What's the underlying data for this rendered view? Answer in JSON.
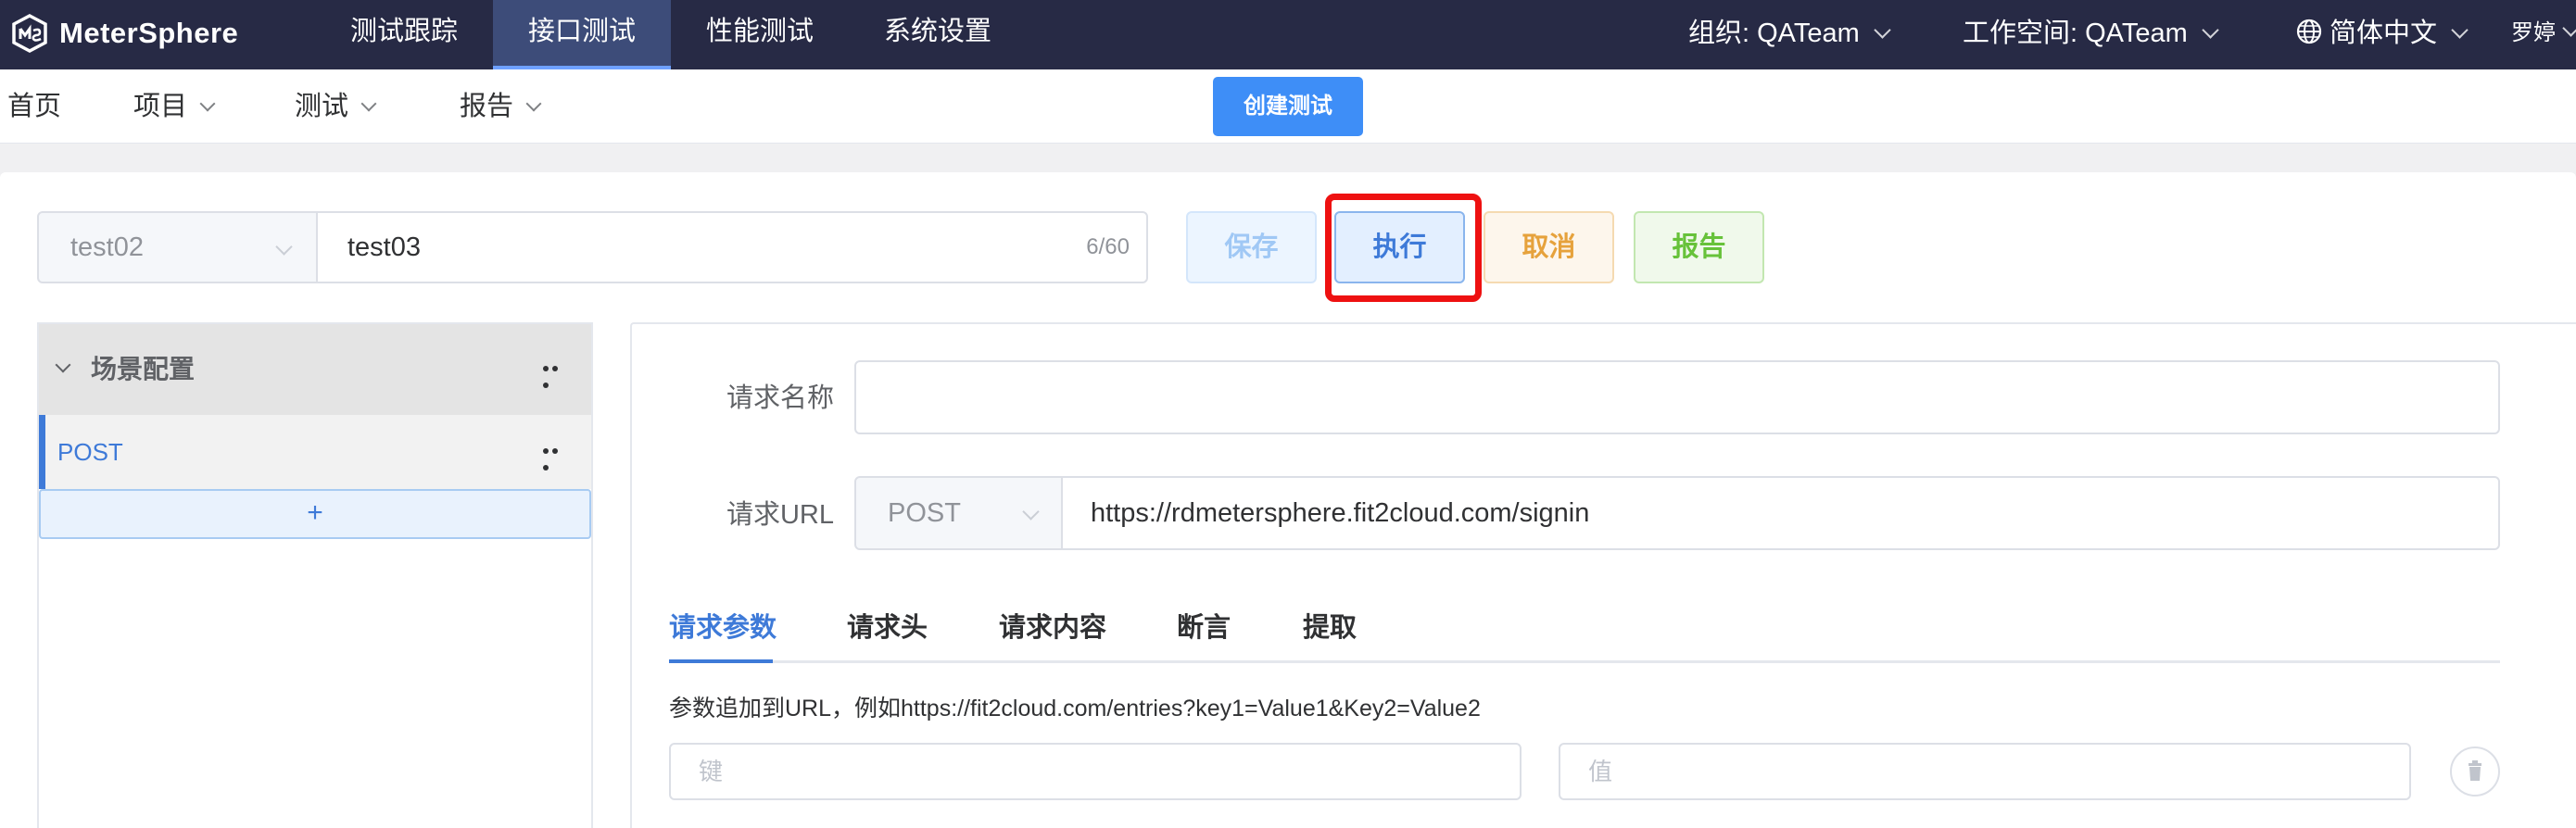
{
  "app": {
    "name": "MeterSphere"
  },
  "topnav": {
    "items": [
      {
        "label": "测试跟踪",
        "active": false
      },
      {
        "label": "接口测试",
        "active": true
      },
      {
        "label": "性能测试",
        "active": false
      },
      {
        "label": "系统设置",
        "active": false
      }
    ],
    "organization": "组织: QATeam",
    "workspace": "工作空间: QATeam",
    "language": "简体中文",
    "user": "罗婷"
  },
  "subnav": {
    "home": "首页",
    "project": "项目",
    "test": "测试",
    "report": "报告",
    "create_button": "创建测试"
  },
  "editor": {
    "environment": "test02",
    "test_name": "test03",
    "name_count": "6/60",
    "buttons": {
      "save": "保存",
      "run": "执行",
      "cancel": "取消",
      "report": "报告"
    }
  },
  "scenario_tree": {
    "header": "场景配置",
    "items": [
      {
        "label": "POST"
      }
    ],
    "add_symbol": "+"
  },
  "request": {
    "name_label": "请求名称",
    "name_value": "",
    "url_label": "请求URL",
    "method": "POST",
    "url": "https://rdmetersphere.fit2cloud.com/signin",
    "tabs": [
      "请求参数",
      "请求头",
      "请求内容",
      "断言",
      "提取"
    ],
    "active_tab": "请求参数",
    "hint": "参数追加到URL，例如https://fit2cloud.com/entries?key1=Value1&Key2=Value2",
    "key_placeholder": "键",
    "value_placeholder": "值"
  },
  "colors": {
    "topbar": "#272a45",
    "accent": "#3e7ad8",
    "primary": "#3e8ef7",
    "highlight": "#ee1111",
    "warning": "#e6a23c",
    "success": "#67c23a"
  }
}
